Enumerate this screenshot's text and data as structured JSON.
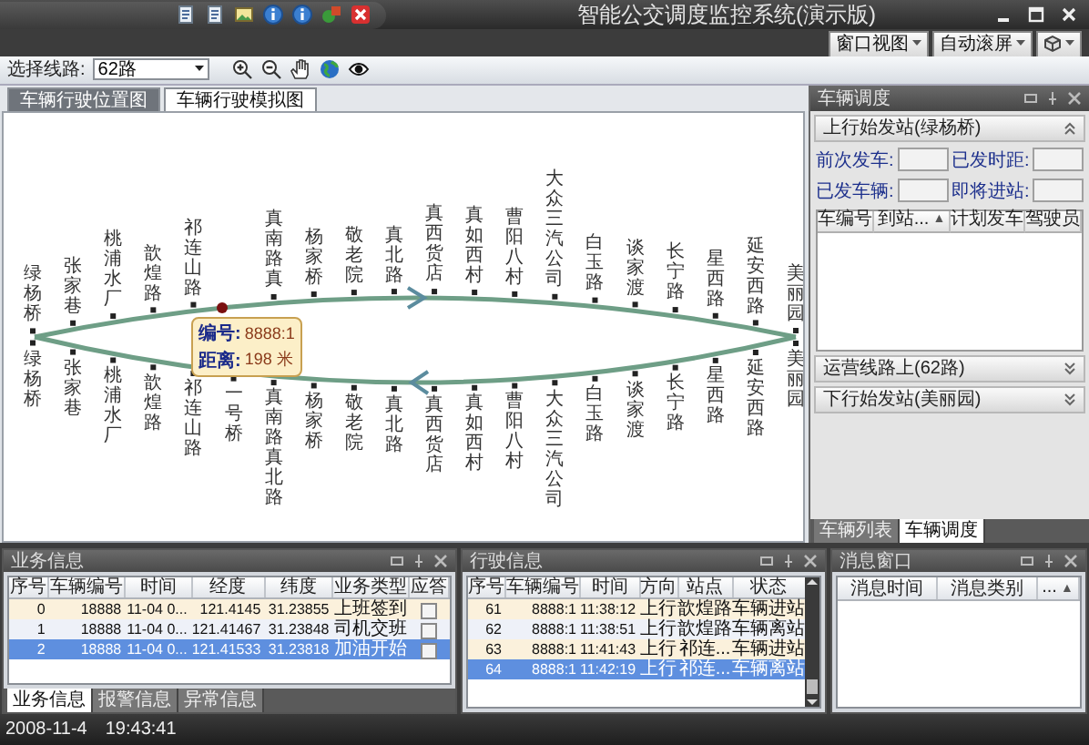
{
  "window": {
    "title": "智能公交调度监控系统(演示版)"
  },
  "menu_buttons": [
    {
      "label": "窗口视图"
    },
    {
      "label": "自动滚屏"
    }
  ],
  "toolbar": {
    "route_label": "选择线路:",
    "route_value": "62路"
  },
  "tabs": [
    {
      "label": "车辆行驶位置图",
      "selected": false
    },
    {
      "label": "车辆行驶模拟图",
      "selected": true
    }
  ],
  "route_map": {
    "stations": [
      {
        "up": "绿杨桥",
        "down": "绿杨桥"
      },
      {
        "up": "张家巷",
        "down": "张家巷"
      },
      {
        "up": "桃浦水厂",
        "down": "桃浦水厂"
      },
      {
        "up": "歆煌路",
        "down": "歆煌路"
      },
      {
        "up": "祁连山路",
        "down": "祁连山路"
      },
      {
        "down": "一号桥"
      },
      {
        "up": "真南路真",
        "down": "真南路真北路"
      },
      {
        "up": "杨家桥",
        "down": "杨家桥"
      },
      {
        "up": "敬老院",
        "down": "敬老院"
      },
      {
        "up": "真北路",
        "down": "真北路"
      },
      {
        "up": "真西货店",
        "down": "真西货店"
      },
      {
        "up": "真如西村",
        "down": "真如西村"
      },
      {
        "up": "曹阳八村",
        "down": "曹阳八村"
      },
      {
        "up": "大众三汽公司",
        "down": "大众三汽公司"
      },
      {
        "up": "白玉路",
        "down": "白玉路"
      },
      {
        "up": "谈家渡",
        "down": "谈家渡"
      },
      {
        "up": "长宁路",
        "down": "长宁路"
      },
      {
        "up": "星西路",
        "down": "星西路"
      },
      {
        "up": "延安西路",
        "down": "延安西路"
      },
      {
        "up": "美丽园",
        "down": "美丽园"
      }
    ],
    "bus_tooltip": {
      "id_label": "编号:",
      "id": "8888:1",
      "distance_label": "距离:",
      "distance": "198 米"
    }
  },
  "dispatch_panel": {
    "title": "车辆调度",
    "sections": [
      {
        "title": "上行始发站(绿杨桥)",
        "expanded": true,
        "fields": [
          {
            "label": "前次发车:"
          },
          {
            "label": "已发时距:"
          },
          {
            "label": "已发车辆:"
          },
          {
            "label": "即将进站:"
          }
        ],
        "columns": [
          {
            "label": "车编号"
          },
          {
            "label": "到站...",
            "arrow": "▲"
          },
          {
            "label": "计划发车"
          },
          {
            "label": "驾驶员"
          }
        ]
      },
      {
        "title": "运营线路上(62路)",
        "expanded": false
      },
      {
        "title": "下行始发站(美丽园)",
        "expanded": false
      }
    ],
    "tabs": [
      {
        "label": "车辆列表",
        "selected": false
      },
      {
        "label": "车辆调度",
        "selected": true
      }
    ]
  },
  "business_panel": {
    "title": "业务信息",
    "columns": [
      {
        "label": "序号"
      },
      {
        "label": "车辆编号"
      },
      {
        "label": "时间"
      },
      {
        "label": "经度"
      },
      {
        "label": "纬度"
      },
      {
        "label": "业务类型"
      },
      {
        "label": "应答",
        "kind": "check"
      }
    ],
    "rows": [
      {
        "cells": [
          "0",
          "18888",
          "11-04 0...",
          "121.4145",
          "31.23855",
          "上班签到"
        ],
        "answered": false,
        "selected": false
      },
      {
        "cells": [
          "1",
          "18888",
          "11-04 0...",
          "121.41467",
          "31.23848",
          "司机交班"
        ],
        "answered": false,
        "selected": false
      },
      {
        "cells": [
          "2",
          "18888",
          "11-04 0...",
          "121.41533",
          "31.23818",
          "加油开始"
        ],
        "answered": false,
        "selected": true
      }
    ],
    "tabs": [
      {
        "label": "业务信息",
        "selected": true
      },
      {
        "label": "报警信息",
        "selected": false
      },
      {
        "label": "异常信息",
        "selected": false
      }
    ]
  },
  "driving_panel": {
    "title": "行驶信息",
    "columns": [
      {
        "label": "序号"
      },
      {
        "label": "车辆编号"
      },
      {
        "label": "时间"
      },
      {
        "label": "方向"
      },
      {
        "label": "站点"
      },
      {
        "label": "状态"
      }
    ],
    "rows": [
      {
        "cells": [
          "61",
          "8888:1",
          "11:38:12",
          "上行",
          "歆煌路",
          "车辆进站"
        ],
        "selected": false
      },
      {
        "cells": [
          "62",
          "8888:1",
          "11:38:51",
          "上行",
          "歆煌路",
          "车辆离站"
        ],
        "selected": false
      },
      {
        "cells": [
          "63",
          "8888:1",
          "11:41:43",
          "上行",
          "祁连...",
          "车辆进站"
        ],
        "selected": false
      },
      {
        "cells": [
          "64",
          "8888:1",
          "11:42:19",
          "上行",
          "祁连...",
          "车辆离站"
        ],
        "selected": true
      }
    ]
  },
  "message_panel": {
    "title": "消息窗口",
    "columns": [
      {
        "label": "消息时间"
      },
      {
        "label": "消息类别"
      },
      {
        "label": "...",
        "arrow": "▲"
      }
    ]
  },
  "status_bar": {
    "date": "2008-11-4",
    "time": "19:43:41"
  }
}
